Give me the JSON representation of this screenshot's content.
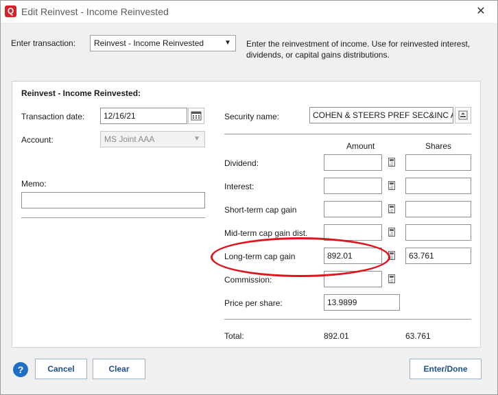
{
  "window": {
    "title": "Edit Reinvest - Income Reinvested",
    "close": "✕"
  },
  "top": {
    "enter_transaction_label": "Enter transaction:",
    "transaction_type": "Reinvest - Income Reinvested",
    "description": "Enter the reinvestment of income. Use for reinvested interest, dividends, or capital gains distributions."
  },
  "form": {
    "section_title": "Reinvest - Income Reinvested:",
    "transaction_date_label": "Transaction date:",
    "transaction_date": "12/16/21",
    "account_label": "Account:",
    "account": "MS Joint AAA",
    "memo_label": "Memo:",
    "memo": "",
    "security_name_label": "Security name:",
    "security_name": "COHEN & STEERS PREF SEC&INC A",
    "col_amount": "Amount",
    "col_shares": "Shares",
    "rows": [
      {
        "label": "Dividend:",
        "amount": "",
        "shares": ""
      },
      {
        "label": "Interest:",
        "amount": "",
        "shares": ""
      },
      {
        "label": "Short-term cap gain",
        "amount": "",
        "shares": ""
      },
      {
        "label": "Mid-term cap gain dist.",
        "amount": "",
        "shares": ""
      },
      {
        "label": "Long-term cap gain",
        "amount": "892.01",
        "shares": "63.761"
      }
    ],
    "commission_label": "Commission:",
    "commission": "",
    "price_per_share_label": "Price per share:",
    "price_per_share": "13.9899",
    "total_label": "Total:",
    "total_amount": "892.01",
    "total_shares": "63.761"
  },
  "buttons": {
    "help": "?",
    "cancel": "Cancel",
    "clear": "Clear",
    "enter_done": "Enter/Done"
  },
  "colors": {
    "annotation": "#e0121b",
    "button_text": "#1f4e8c",
    "app_icon": "#d8202a"
  }
}
